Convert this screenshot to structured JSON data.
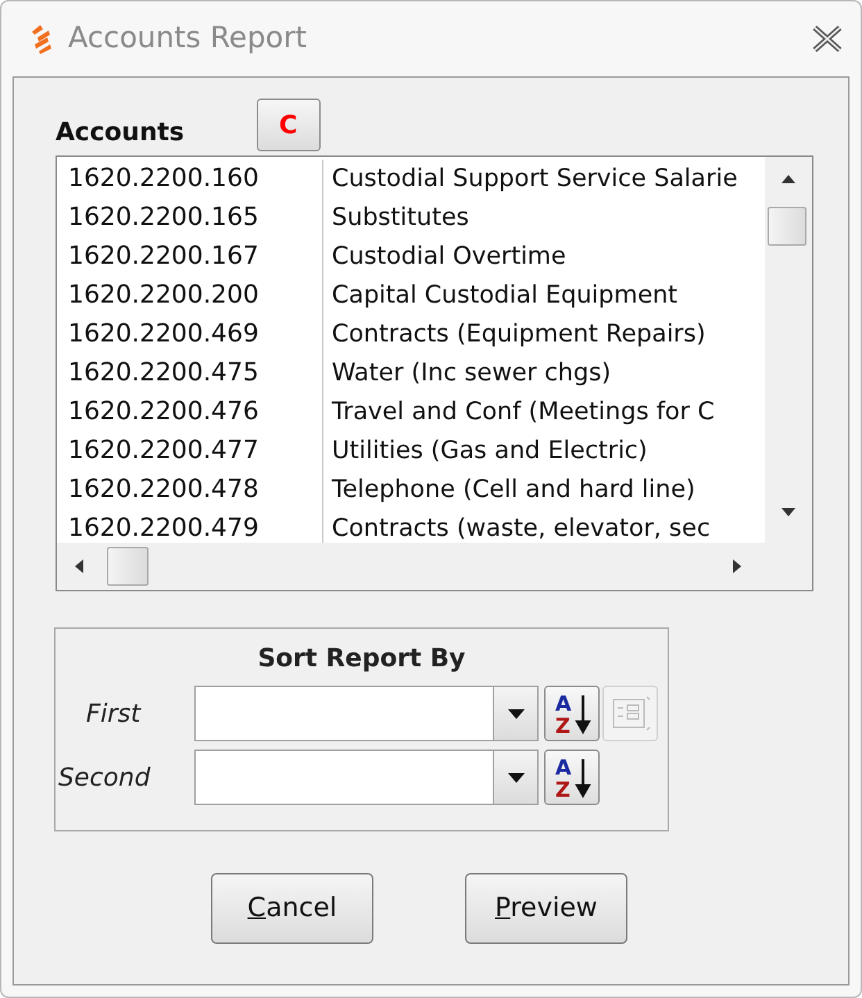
{
  "window": {
    "title": "Accounts Report"
  },
  "accounts": {
    "label": "Accounts",
    "clear_button": "C",
    "rows": [
      {
        "code": "1620.2200.160",
        "description": "Custodial Support Service Salarie"
      },
      {
        "code": "1620.2200.165",
        "description": "Substitutes"
      },
      {
        "code": "1620.2200.167",
        "description": "Custodial Overtime"
      },
      {
        "code": "1620.2200.200",
        "description": "Capital Custodial Equipment"
      },
      {
        "code": "1620.2200.469",
        "description": "Contracts (Equipment Repairs)"
      },
      {
        "code": "1620.2200.475",
        "description": "Water (Inc sewer chgs)"
      },
      {
        "code": "1620.2200.476",
        "description": "Travel and Conf (Meetings for C"
      },
      {
        "code": "1620.2200.477",
        "description": "Utilities (Gas and Electric)"
      },
      {
        "code": "1620.2200.478",
        "description": "Telephone (Cell and hard line)"
      },
      {
        "code": "1620.2200.479",
        "description": "Contracts (waste, elevator, sec"
      }
    ]
  },
  "sort": {
    "title": "Sort Report By",
    "rows": [
      {
        "label": "First",
        "sort_icon": {
          "top": "A",
          "bottom": "Z"
        },
        "extra_button": true
      },
      {
        "label": "Second",
        "sort_icon": {
          "top": "A",
          "bottom": "Z"
        },
        "extra_button": false
      }
    ]
  },
  "buttons": [
    {
      "mnemonic": "C",
      "rest": "ancel"
    },
    {
      "mnemonic": "P",
      "rest": "review"
    }
  ]
}
